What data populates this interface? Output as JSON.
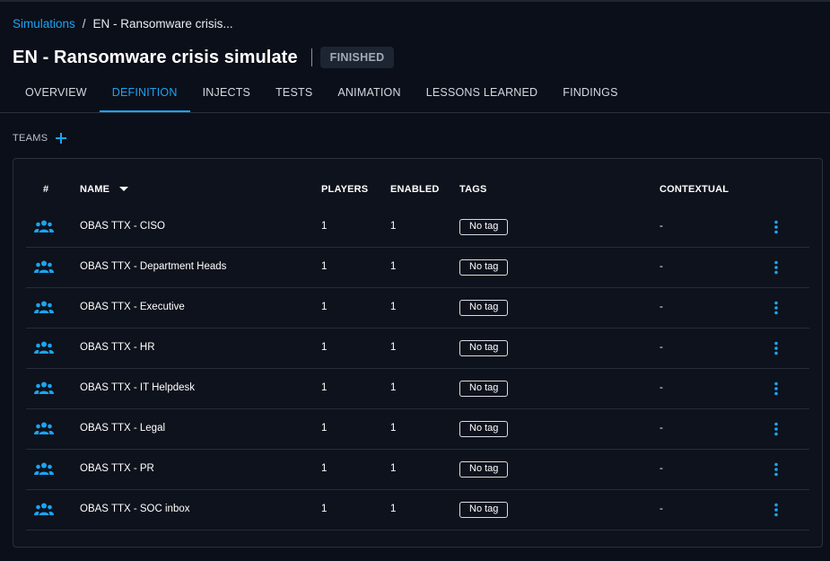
{
  "breadcrumb": {
    "root": "Simulations",
    "separator": "/",
    "current": "EN - Ransomware crisis..."
  },
  "header": {
    "title": "EN - Ransomware crisis simulate",
    "status": "FINISHED"
  },
  "tabs": [
    {
      "label": "OVERVIEW",
      "active": false
    },
    {
      "label": "DEFINITION",
      "active": true
    },
    {
      "label": "INJECTS",
      "active": false
    },
    {
      "label": "TESTS",
      "active": false
    },
    {
      "label": "ANIMATION",
      "active": false
    },
    {
      "label": "LESSONS LEARNED",
      "active": false
    },
    {
      "label": "FINDINGS",
      "active": false
    }
  ],
  "teams": {
    "label": "TEAMS",
    "add_icon": "plus-icon",
    "columns": {
      "index": "#",
      "name": "NAME",
      "players": "PLAYERS",
      "enabled": "ENABLED",
      "tags": "TAGS",
      "contextual": "CONTEXTUAL"
    },
    "rows": [
      {
        "name": "OBAS TTX - CISO",
        "players": "1",
        "enabled": "1",
        "tag": "No tag",
        "contextual": "-"
      },
      {
        "name": "OBAS TTX - Department Heads",
        "players": "1",
        "enabled": "1",
        "tag": "No tag",
        "contextual": "-"
      },
      {
        "name": "OBAS TTX - Executive",
        "players": "1",
        "enabled": "1",
        "tag": "No tag",
        "contextual": "-"
      },
      {
        "name": "OBAS TTX - HR",
        "players": "1",
        "enabled": "1",
        "tag": "No tag",
        "contextual": "-"
      },
      {
        "name": "OBAS TTX - IT Helpdesk",
        "players": "1",
        "enabled": "1",
        "tag": "No tag",
        "contextual": "-"
      },
      {
        "name": "OBAS TTX - Legal",
        "players": "1",
        "enabled": "1",
        "tag": "No tag",
        "contextual": "-"
      },
      {
        "name": "OBAS TTX - PR",
        "players": "1",
        "enabled": "1",
        "tag": "No tag",
        "contextual": "-"
      },
      {
        "name": "OBAS TTX - SOC inbox",
        "players": "1",
        "enabled": "1",
        "tag": "No tag",
        "contextual": "-"
      }
    ]
  },
  "colors": {
    "accent": "#1ba4f2",
    "background": "#0b0f19",
    "panel": "#0d121c"
  }
}
